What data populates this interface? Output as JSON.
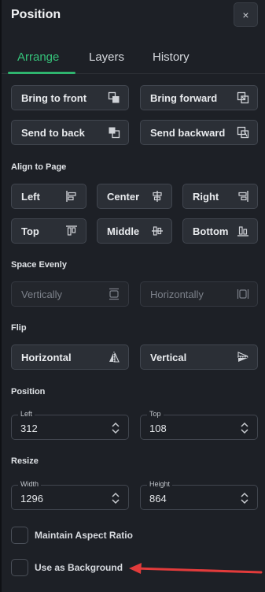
{
  "panel": {
    "title": "Position",
    "close_symbol": "×"
  },
  "tabs": [
    {
      "label": "Arrange",
      "active": true
    },
    {
      "label": "Layers",
      "active": false
    },
    {
      "label": "History",
      "active": false
    }
  ],
  "arrange": {
    "bring_to_front": "Bring to front",
    "bring_forward": "Bring forward",
    "send_to_back": "Send to back",
    "send_backward": "Send backward"
  },
  "align": {
    "heading": "Align to Page",
    "left": "Left",
    "center": "Center",
    "right": "Right",
    "top": "Top",
    "middle": "Middle",
    "bottom": "Bottom"
  },
  "space": {
    "heading": "Space Evenly",
    "vertically": "Vertically",
    "horizontally": "Horizontally"
  },
  "flip": {
    "heading": "Flip",
    "horizontal": "Horizontal",
    "vertical": "Vertical"
  },
  "position": {
    "heading": "Position",
    "left_label": "Left",
    "left_value": "312",
    "top_label": "Top",
    "top_value": "108"
  },
  "resize": {
    "heading": "Resize",
    "width_label": "Width",
    "width_value": "1296",
    "height_label": "Height",
    "height_value": "864"
  },
  "options": {
    "maintain_aspect": "Maintain Aspect Ratio",
    "use_background": "Use as Background"
  },
  "colors": {
    "accent": "#35c27a",
    "arrow": "#e23b3b"
  }
}
